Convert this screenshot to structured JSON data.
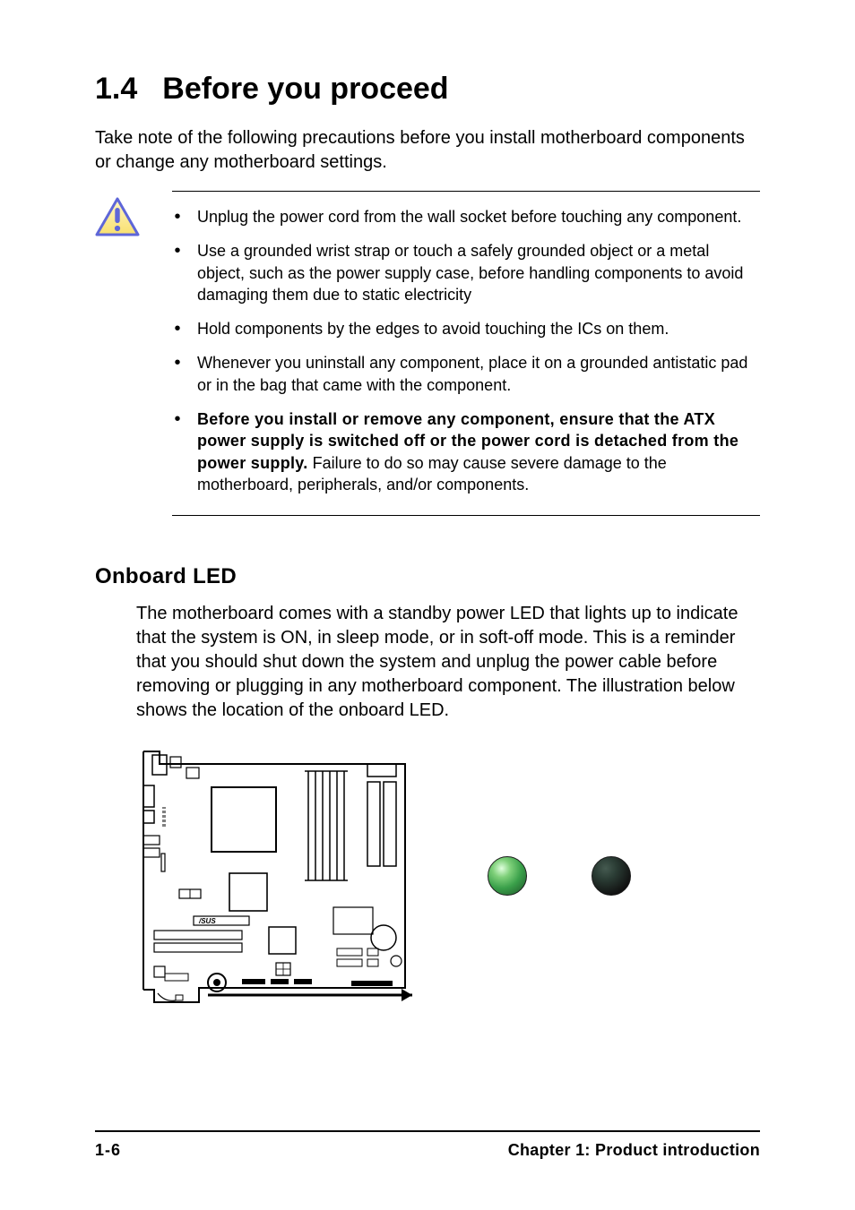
{
  "heading": {
    "number": "1.4",
    "title": "Before you proceed"
  },
  "intro": "Take note of the following precautions before you install motherboard components or change any motherboard settings.",
  "notes": {
    "items": [
      {
        "text": "Unplug the power cord from the wall socket before touching any component."
      },
      {
        "text": "Use a grounded wrist strap or touch a safely grounded object or a metal object, such as the power supply case, before handling components to avoid damaging them due to static electricity"
      },
      {
        "text": "Hold components by the edges to avoid touching the ICs on them."
      },
      {
        "text": "Whenever you uninstall any component, place it on a grounded antistatic pad or in the bag that came with the component."
      },
      {
        "bold_prefix": "Before you install or remove any component, ensure that the ATX power supply is switched off or the power cord is detached from the power supply.",
        "text": " Failure to do so may cause severe damage to the motherboard, peripherals, and/or components."
      }
    ]
  },
  "section": {
    "title": "Onboard LED",
    "body": "The motherboard comes with a standby power LED that lights up to indicate that the system is ON, in sleep mode, or in soft-off mode. This is a reminder that you should shut down the system and unplug the power cable before removing or plugging in any motherboard component. The illustration below shows the location of the onboard LED."
  },
  "leds": {
    "on": "led-on",
    "off": "led-off"
  },
  "icons": {
    "caution": "caution-icon",
    "mobo_diagram": "motherboard-diagram",
    "pointer_arrow": "pointer-arrow-icon"
  },
  "footer": {
    "page": "1-6",
    "chapter": "Chapter 1: Product introduction"
  }
}
